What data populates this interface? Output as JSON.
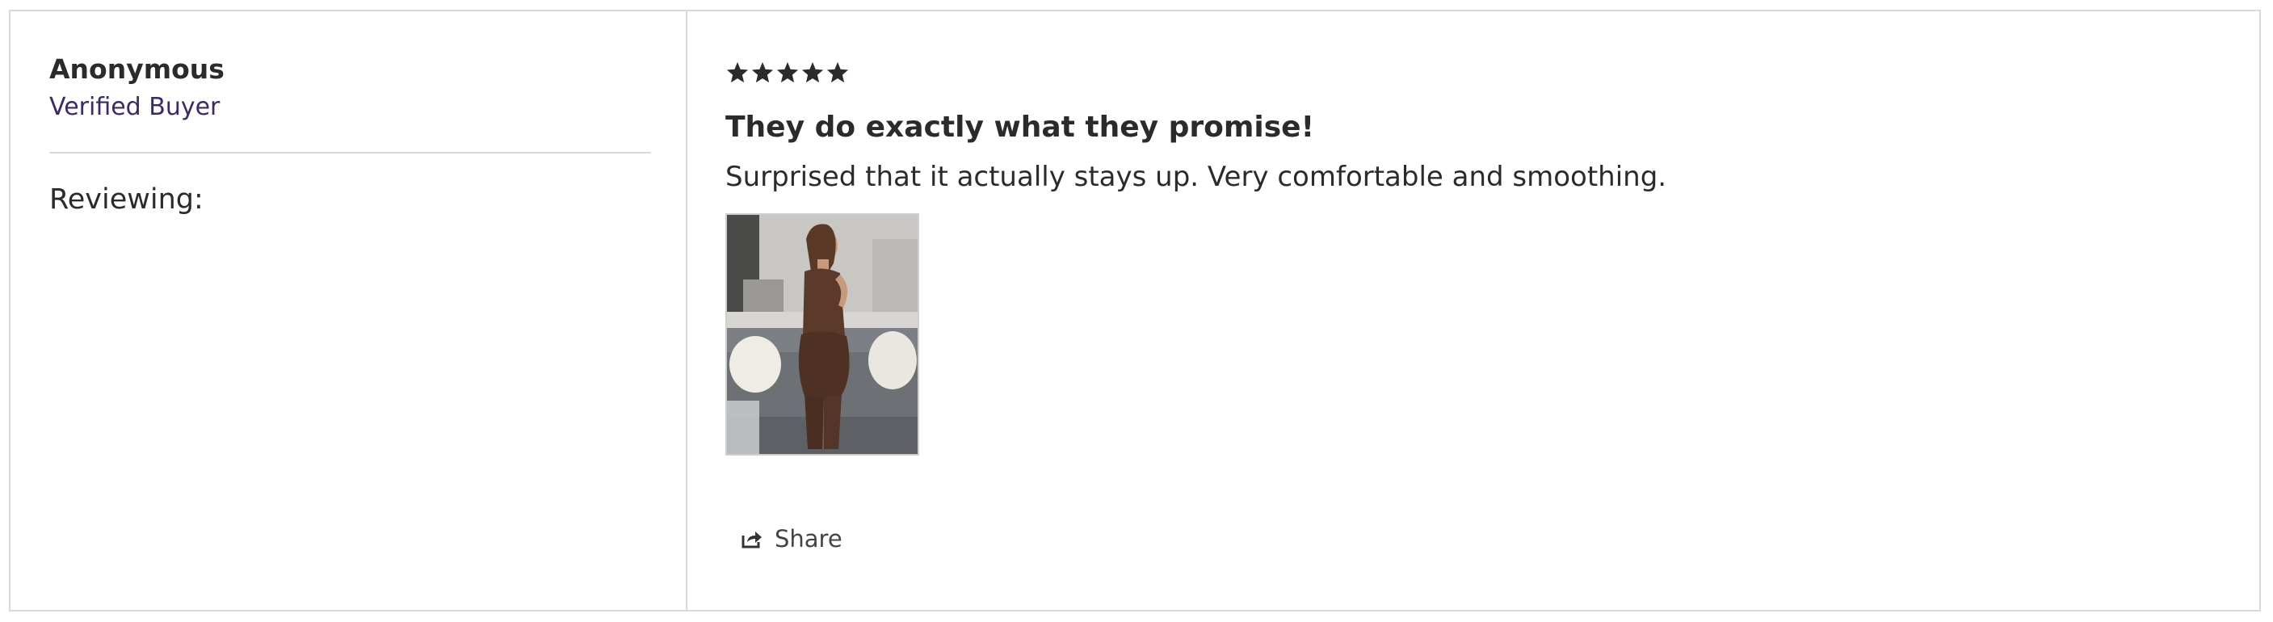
{
  "reviewer": {
    "name": "Anonymous",
    "badge": "Verified Buyer",
    "reviewing_label": "Reviewing:"
  },
  "review": {
    "rating": 5,
    "max_rating": 5,
    "title": "They do exactly what they promise!",
    "body": "Surprised that it actually stays up. Very comfortable and smoothing.",
    "photo_icon": "review-photo"
  },
  "actions": {
    "share_label": "Share",
    "share_icon": "share-icon"
  },
  "colors": {
    "text": "#2b2b2b",
    "badge": "#3a2a6b",
    "border": "#d9d9d9",
    "star": "#2b2b2b"
  }
}
